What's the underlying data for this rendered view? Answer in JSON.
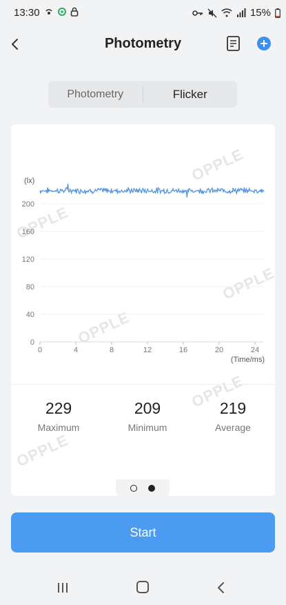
{
  "status_bar": {
    "time": "13:30",
    "battery": "15%"
  },
  "header": {
    "title": "Photometry"
  },
  "tabs": [
    {
      "label": "Photometry",
      "active": false
    },
    {
      "label": "Flicker",
      "active": true
    }
  ],
  "chart_data": {
    "type": "line",
    "ylabel": "(lx)",
    "xlabel": "(Time/ms)",
    "xlim": [
      0,
      25
    ],
    "ylim": [
      0,
      220
    ],
    "y_ticks": [
      "0",
      "40",
      "80",
      "120",
      "160",
      "200"
    ],
    "x_ticks": [
      "0",
      "4",
      "8",
      "12",
      "16",
      "20",
      "24"
    ],
    "grid": true,
    "series": [
      {
        "color": "#4a90e2",
        "mean": 219,
        "min": 209,
        "max": 229
      }
    ]
  },
  "stats": [
    {
      "value": "229",
      "label": "Maximum"
    },
    {
      "value": "209",
      "label": "Minimum"
    },
    {
      "value": "219",
      "label": "Average"
    }
  ],
  "watermark": "OPPLE",
  "pager": {
    "pages": 2,
    "current": 2
  },
  "start_button": {
    "label": "Start"
  },
  "colors": {
    "accent": "#4b9cf1",
    "series": "#4a90e2"
  }
}
